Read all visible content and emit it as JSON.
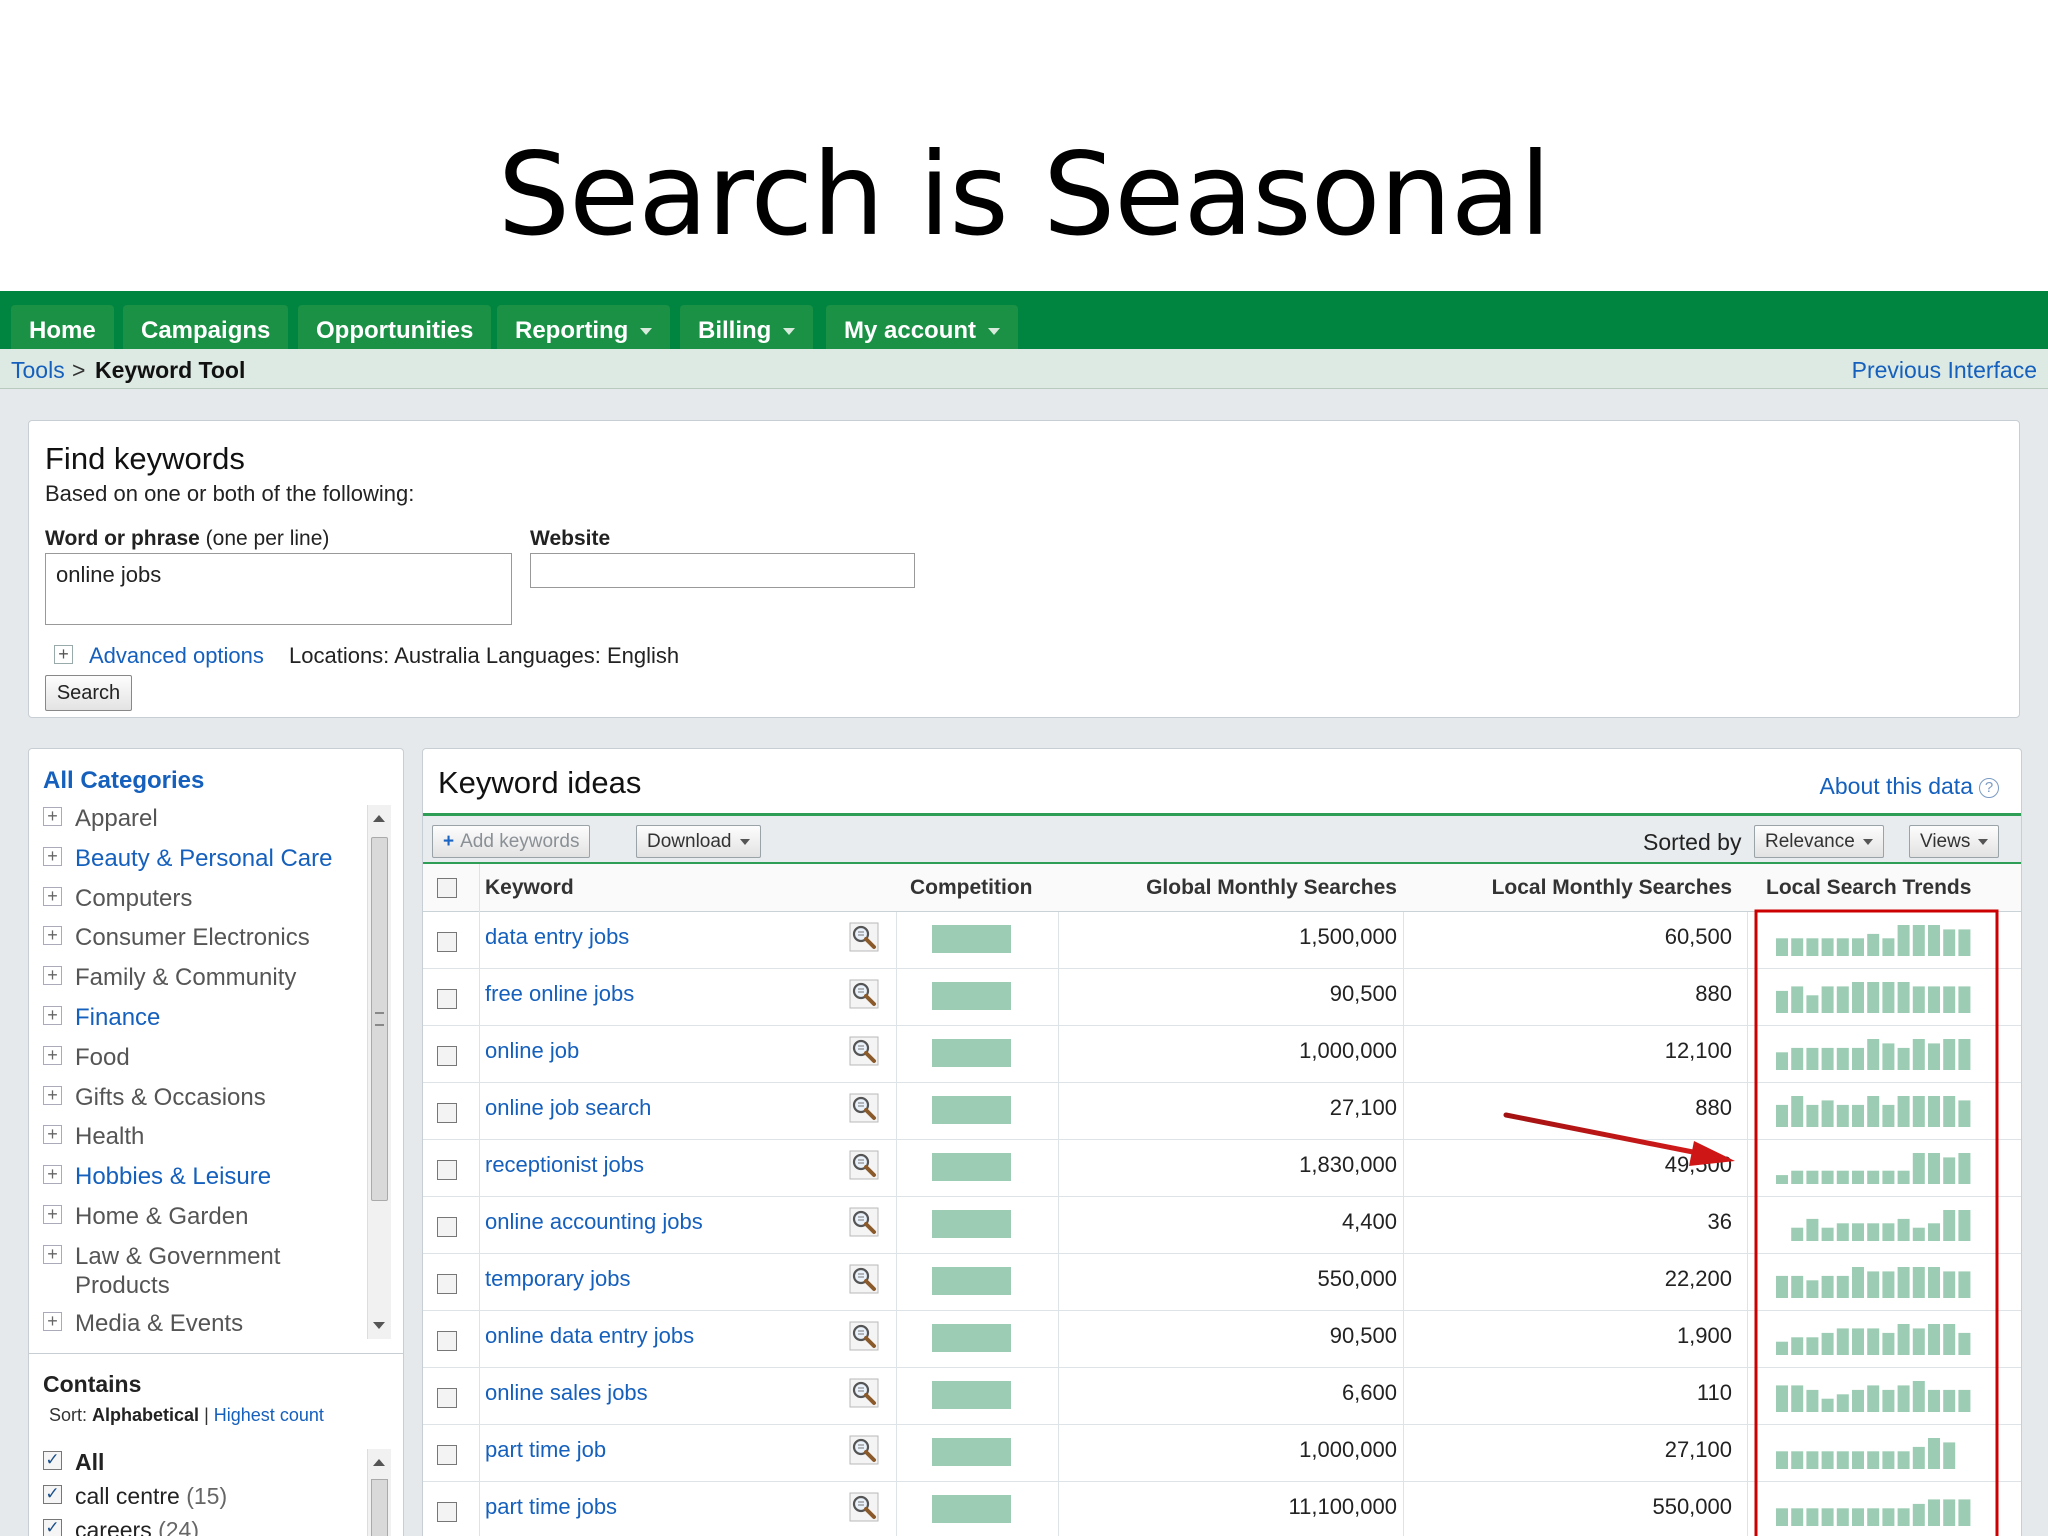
{
  "slide": {
    "title": "Search is Seasonal"
  },
  "nav": {
    "tabs": [
      {
        "label": "Home",
        "dropdown": false
      },
      {
        "label": "Campaigns",
        "dropdown": false
      },
      {
        "label": "Opportunities",
        "dropdown": false
      },
      {
        "label": "Reporting",
        "dropdown": true
      },
      {
        "label": "Billing",
        "dropdown": true
      },
      {
        "label": "My account",
        "dropdown": true
      }
    ]
  },
  "breadcrumb": {
    "parent": "Tools",
    "separator": ">",
    "current": "Keyword Tool",
    "previous_interface": "Previous Interface"
  },
  "find": {
    "title": "Find keywords",
    "subtitle": "Based on one or both of the following:",
    "word_label": "Word or phrase",
    "word_hint": "(one per line)",
    "word_value": "online jobs",
    "website_label": "Website",
    "website_value": "",
    "advanced_options": "Advanced options",
    "locations": "Locations: Australia  Languages: English",
    "search_button": "Search"
  },
  "categories": {
    "title": "All Categories",
    "items": [
      {
        "label": "Apparel",
        "link": false
      },
      {
        "label": "Beauty & Personal Care",
        "link": true
      },
      {
        "label": "Computers",
        "link": false
      },
      {
        "label": "Consumer Electronics",
        "link": false
      },
      {
        "label": "Family & Community",
        "link": false
      },
      {
        "label": "Finance",
        "link": true
      },
      {
        "label": "Food",
        "link": false
      },
      {
        "label": "Gifts & Occasions",
        "link": false
      },
      {
        "label": "Health",
        "link": false
      },
      {
        "label": "Hobbies & Leisure",
        "link": true
      },
      {
        "label": "Home & Garden",
        "link": false
      },
      {
        "label": "Law & Government",
        "label2": "Products",
        "link": false
      },
      {
        "label": "Media & Events",
        "link": false
      }
    ],
    "contains_title": "Contains",
    "sort_label": "Sort:",
    "sort_active": "Alphabetical",
    "sort_sep": "|",
    "sort_other": "Highest count",
    "checks": [
      {
        "label": "All",
        "count": "",
        "bold": true
      },
      {
        "label": "call centre",
        "count": "(15)",
        "bold": false
      },
      {
        "label": "careers",
        "count": "(24)",
        "bold": false
      }
    ]
  },
  "ideas": {
    "title": "Keyword ideas",
    "about": "About this data",
    "about_icon": "?",
    "add_keywords": "Add keywords",
    "add_icon": "+",
    "download": "Download",
    "sorted_by": "Sorted by",
    "sort_value": "Relevance",
    "views": "Views",
    "columns": {
      "keyword": "Keyword",
      "competition": "Competition",
      "global": "Global Monthly Searches",
      "local": "Local Monthly Searches",
      "trends": "Local Search Trends"
    },
    "rows": [
      {
        "keyword": "data entry jobs",
        "global": "1,500,000",
        "local": "60,500",
        "competition": 1.0,
        "trend": [
          4,
          4,
          4,
          4,
          4,
          4,
          5,
          4,
          7,
          7,
          7,
          6,
          6
        ]
      },
      {
        "keyword": "free online jobs",
        "global": "90,500",
        "local": "880",
        "competition": 1.0,
        "trend": [
          5,
          6,
          4,
          6,
          6,
          7,
          7,
          7,
          7,
          6,
          6,
          6,
          6
        ]
      },
      {
        "keyword": "online job",
        "global": "1,000,000",
        "local": "12,100",
        "competition": 1.0,
        "trend": [
          4,
          5,
          5,
          5,
          5,
          5,
          7,
          6,
          5,
          7,
          6,
          7,
          7
        ]
      },
      {
        "keyword": "online job search",
        "global": "27,100",
        "local": "880",
        "competition": 1.0,
        "trend": [
          5,
          7,
          5,
          6,
          5,
          5,
          7,
          5,
          7,
          7,
          7,
          7,
          6
        ]
      },
      {
        "keyword": "receptionist jobs",
        "global": "1,830,000",
        "local": "49,500",
        "competition": 1.0,
        "trend": [
          2,
          3,
          3,
          3,
          3,
          3,
          3,
          3,
          3,
          7,
          7,
          6,
          7
        ]
      },
      {
        "keyword": "online accounting jobs",
        "global": "4,400",
        "local": "36",
        "competition": 1.0,
        "trend": [
          0,
          3,
          5,
          3,
          4,
          4,
          4,
          4,
          5,
          3,
          4,
          7,
          7
        ]
      },
      {
        "keyword": "temporary jobs",
        "global": "550,000",
        "local": "22,200",
        "competition": 1.0,
        "trend": [
          5,
          5,
          4,
          5,
          5,
          7,
          6,
          6,
          7,
          7,
          7,
          6,
          6
        ]
      },
      {
        "keyword": "online data entry jobs",
        "global": "90,500",
        "local": "1,900",
        "competition": 1.0,
        "trend": [
          3,
          4,
          4,
          5,
          6,
          6,
          6,
          5,
          7,
          6,
          7,
          7,
          5
        ]
      },
      {
        "keyword": "online sales jobs",
        "global": "6,600",
        "local": "110",
        "competition": 1.0,
        "trend": [
          6,
          6,
          5,
          3,
          4,
          5,
          6,
          5,
          6,
          7,
          5,
          5,
          5
        ]
      },
      {
        "keyword": "part time job",
        "global": "1,000,000",
        "local": "27,100",
        "competition": 1.0,
        "trend": [
          4,
          4,
          4,
          4,
          4,
          4,
          4,
          4,
          4,
          5,
          7,
          6,
          0
        ]
      },
      {
        "keyword": "part time jobs",
        "global": "11,100,000",
        "local": "550,000",
        "competition": 1.0,
        "trend": [
          4,
          4,
          4,
          4,
          4,
          4,
          4,
          4,
          4,
          5,
          6,
          6,
          6
        ]
      }
    ]
  },
  "colors": {
    "nav_green": "#008540",
    "link_blue": "#1560bd",
    "competition_bar": "#9ccdb4",
    "trend_bar": "#9ccdb4",
    "highlight_red": "#cc0000"
  },
  "icons": {
    "magnifier": "magnifier-icon",
    "expand": "plus-box-icon",
    "caret": "chevron-down-icon",
    "arrow": "red-arrow-annotation"
  }
}
